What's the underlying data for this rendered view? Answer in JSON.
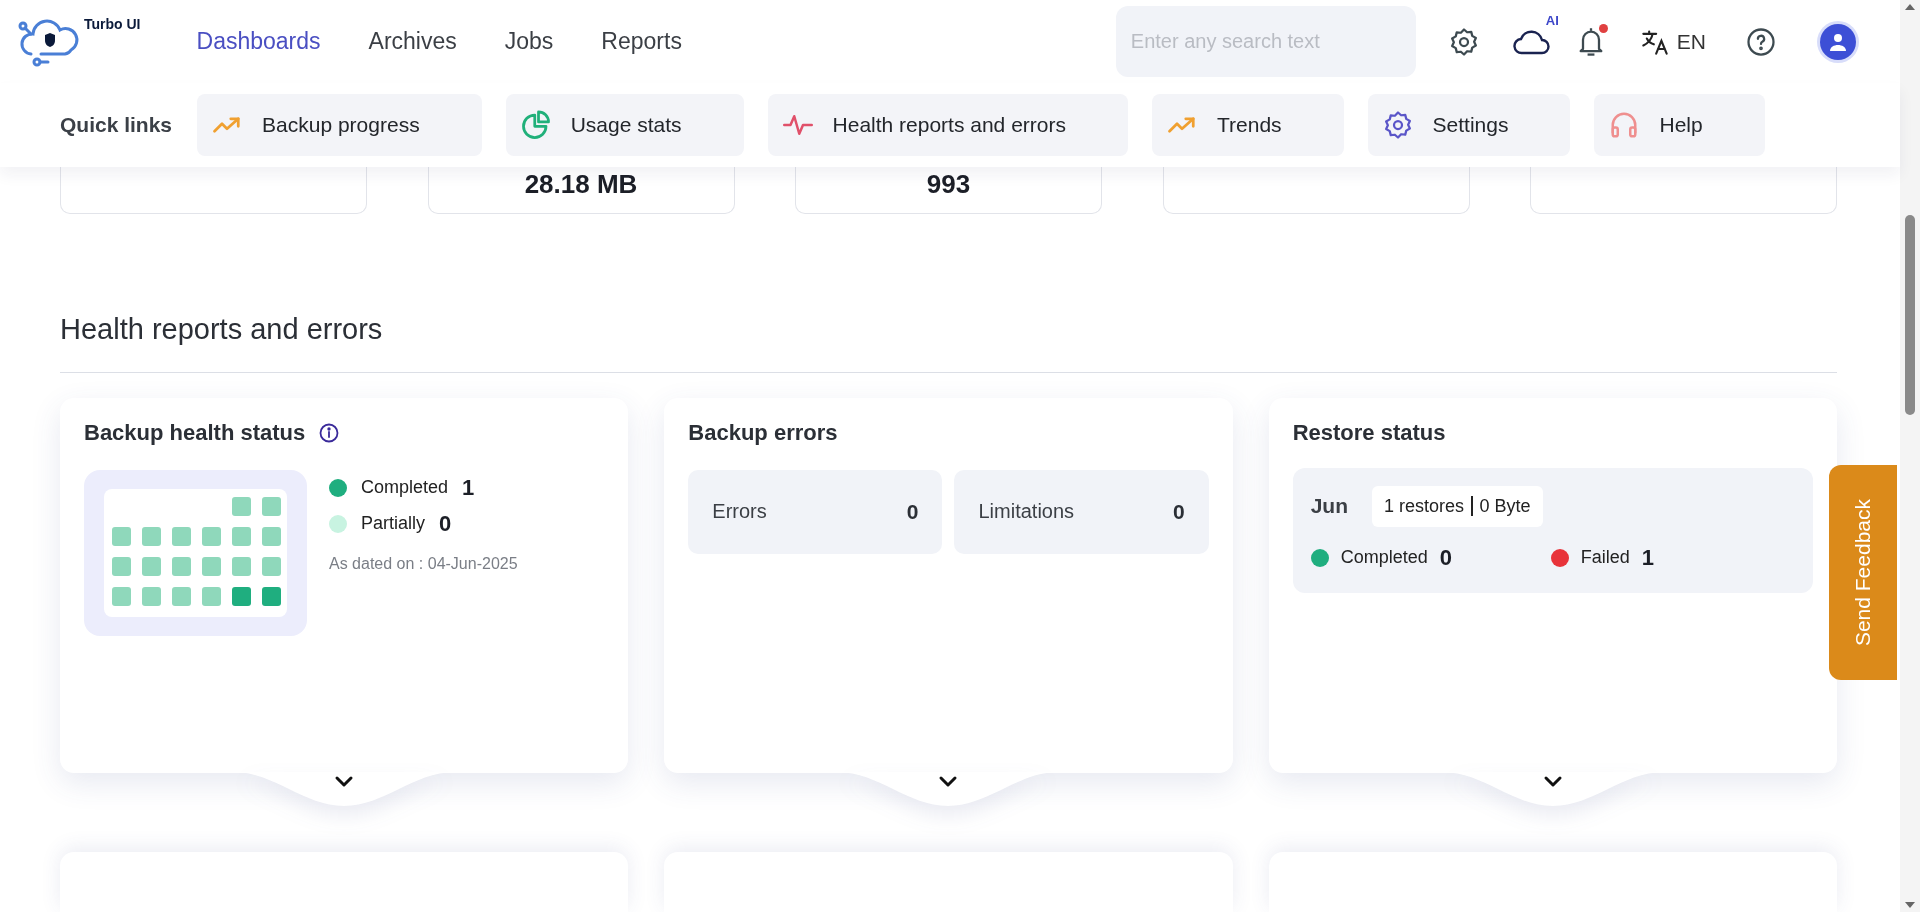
{
  "brand": {
    "name": "Turbo UI"
  },
  "nav": [
    {
      "label": "Dashboards",
      "selected": true
    },
    {
      "label": "Archives",
      "selected": false
    },
    {
      "label": "Jobs",
      "selected": false
    },
    {
      "label": "Reports",
      "selected": false
    }
  ],
  "search": {
    "placeholder": "Enter any search text"
  },
  "ai_badge": "AI",
  "notifications": {
    "unread": true
  },
  "language": "EN",
  "quick_links": {
    "title": "Quick links",
    "items": [
      {
        "label": "Backup progress",
        "kind": "trend"
      },
      {
        "label": "Usage stats",
        "kind": "pie"
      },
      {
        "label": "Health reports and errors",
        "kind": "pulse"
      },
      {
        "label": "Trends",
        "kind": "trend"
      },
      {
        "label": "Settings",
        "kind": "gear"
      },
      {
        "label": "Help",
        "kind": "headset"
      }
    ]
  },
  "stat_cards": [
    {
      "kind": "blank"
    },
    {
      "kind": "value",
      "value": "28.18 MB"
    },
    {
      "kind": "value",
      "value": "993"
    },
    {
      "kind": "blank"
    },
    {
      "kind": "blank"
    }
  ],
  "section": {
    "title": "Health reports and errors"
  },
  "health_card": {
    "title": "Backup health status",
    "legend": [
      {
        "label": "Completed",
        "count": "1",
        "color": "#1fae7f"
      },
      {
        "label": "Partially",
        "count": "0",
        "color": "#c8f3e1"
      }
    ],
    "as_of": "As dated on : 04-Jun-2025"
  },
  "errors_card": {
    "title": "Backup errors",
    "tiles": [
      {
        "label": "Errors",
        "count": "0"
      },
      {
        "label": "Limitations",
        "count": "0"
      }
    ]
  },
  "restore_card": {
    "title": "Restore status",
    "month": "Jun",
    "restores": "1 restores",
    "size": "0 Byte",
    "legend": [
      {
        "label": "Completed",
        "count": "0",
        "color": "#1fae7f"
      },
      {
        "label": "Failed",
        "count": "1",
        "color": "#e8333a"
      }
    ]
  },
  "feedback": {
    "label": "Send Feedback"
  }
}
